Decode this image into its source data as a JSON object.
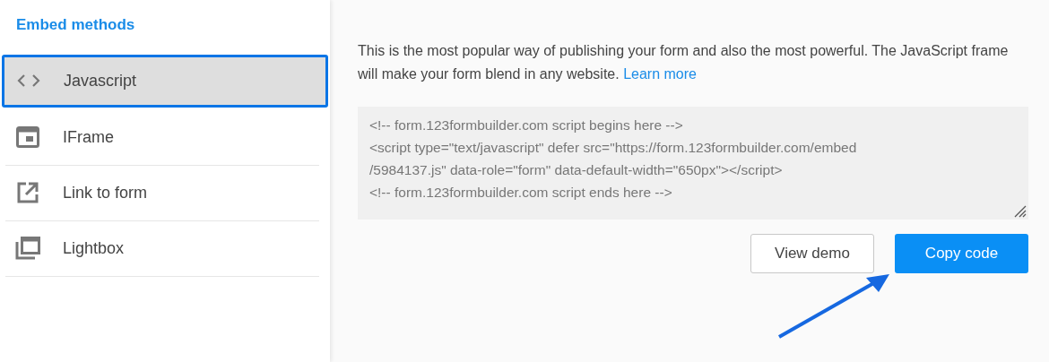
{
  "sidebar": {
    "title": "Embed methods",
    "items": [
      {
        "label": "Javascript",
        "kind": "code",
        "selected": true
      },
      {
        "label": "IFrame",
        "kind": "iframe",
        "selected": false
      },
      {
        "label": "Link to form",
        "kind": "link",
        "selected": false
      },
      {
        "label": "Lightbox",
        "kind": "lightbox",
        "selected": false
      }
    ]
  },
  "description": {
    "text": "This is the most popular way of publishing your form and also the most powerful. The JavaScript frame will make your form blend in any website.",
    "link": "Learn more"
  },
  "code_lines": [
    "<!-- form.123formbuilder.com script begins here -->",
    "<script type=\"text/javascript\" defer src=\"https://form.123formbuilder.com/embed",
    "/5984137.js\" data-role=\"form\" data-default-width=\"650px\"></script>",
    "<!-- form.123formbuilder.com script ends here -->"
  ],
  "buttons": [
    {
      "label": "View demo",
      "kind": "secondary"
    },
    {
      "label": "Copy code",
      "kind": "primary"
    }
  ]
}
